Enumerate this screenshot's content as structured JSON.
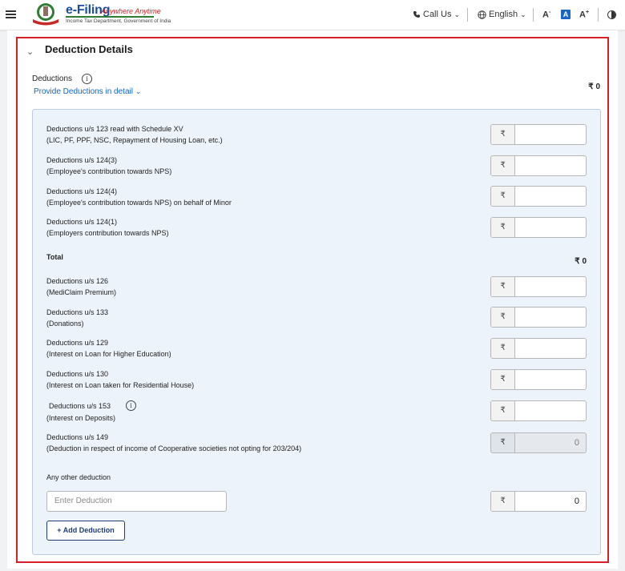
{
  "header": {
    "logo_title": "e-Filing",
    "logo_tagline": "Anywhere Anytime",
    "logo_subtitle": "Income Tax Department, Government of India",
    "call_us": "Call Us",
    "language": "English",
    "font_decrease": "A",
    "font_normal": "A",
    "font_increase": "A",
    "font_decrease_sup": "-",
    "font_increase_sup": "+"
  },
  "section": {
    "title": "Deduction Details",
    "deductions_label": "Deductions",
    "provide_link": "Provide Deductions in detail",
    "deductions_total": "₹ 0"
  },
  "currency_symbol": "₹",
  "rows_group1": [
    {
      "line1": "Deductions u/s 123 read with Schedule XV",
      "line2": "(LIC, PF, PPF, NSC, Repayment of Housing Loan, etc.)",
      "value": ""
    },
    {
      "line1": "Deductions u/s 124(3)",
      "line2": "(Employee's contribution towards NPS)",
      "value": ""
    },
    {
      "line1": "Deductions u/s 124(4)",
      "line2": "(Employee's contribution towards NPS) on behalf of Minor",
      "value": ""
    },
    {
      "line1": "Deductions u/s 124(1)",
      "line2": "(Employers contribution towards NPS)",
      "value": ""
    }
  ],
  "total": {
    "label": "Total",
    "value": "₹ 0"
  },
  "rows_group2": [
    {
      "line1": "Deductions u/s 126",
      "line2": "(MediClaim Premium)",
      "value": ""
    },
    {
      "line1": "Deductions u/s 133",
      "line2": "(Donations)",
      "value": ""
    },
    {
      "line1": "Deductions u/s 129",
      "line2": "(Interest on Loan for Higher Education)",
      "value": ""
    },
    {
      "line1": "Deductions u/s 130",
      "line2": "(Interest on Loan taken for Residential House)",
      "value": ""
    },
    {
      "line1": "Deductions u/s 153",
      "line2": "(Interest on Deposits)",
      "value": ""
    },
    {
      "line1": "Deductions u/s 149",
      "line2": "(Deduction in respect of income of Cooperative societies not opting for 203/204)",
      "value": "0"
    }
  ],
  "other": {
    "label": "Any other deduction",
    "placeholder": "Enter Deduction",
    "value": "0",
    "add_button": "+ Add Deduction"
  },
  "colors": {
    "frame": "#d61f26",
    "link": "#1565c0",
    "panel": "#edf3fb",
    "button": "#1e3c72"
  }
}
